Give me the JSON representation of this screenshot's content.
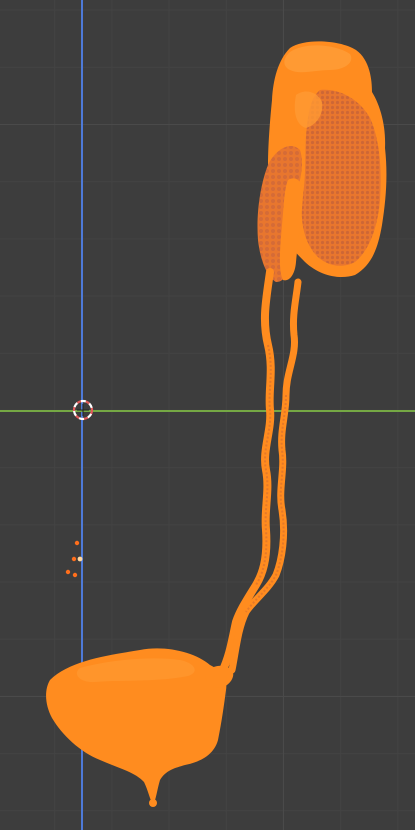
{
  "viewport": {
    "background_color": "#3d3d3d",
    "grid_major_color": "#4a4a4a",
    "grid_minor_color": "#434343"
  },
  "axes": {
    "z_axis_color": "#4e7ad8",
    "y_axis_color": "#75a844"
  },
  "cursor": {
    "icon": "3d-cursor-icon",
    "color_primary": "#e35b5b",
    "color_secondary": "#ffffff"
  },
  "light": {
    "icon": "light-icon",
    "color": "#ff6f1c",
    "center_color": "#ffd7a0"
  },
  "model": {
    "name_icon": "urinary-system-mesh",
    "selection_color": "#ff8c1f",
    "dense_color": "#e8762e",
    "highlight_color": "#ff9a33"
  }
}
